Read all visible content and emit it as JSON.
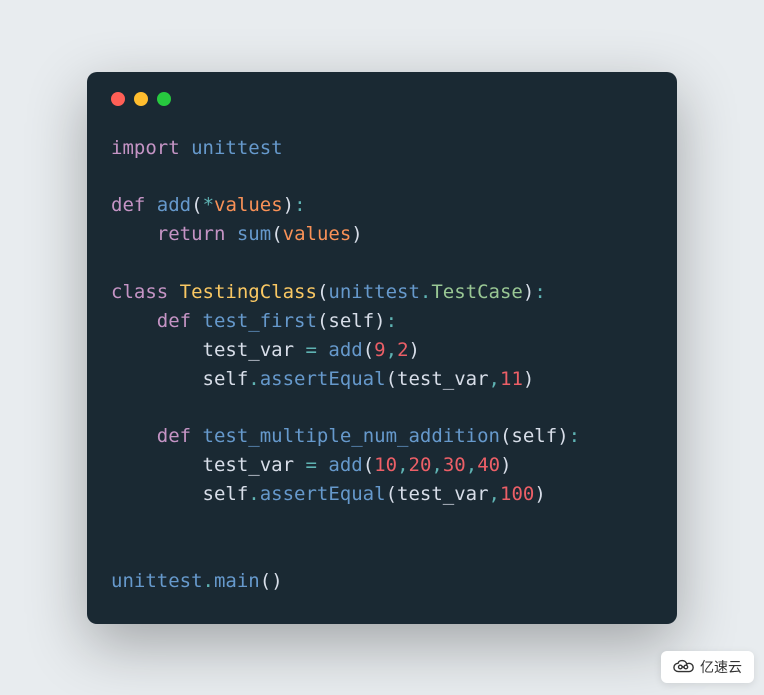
{
  "code": {
    "line1": {
      "kw": "import",
      "mod": "unittest"
    },
    "line3": {
      "kw": "def",
      "fn": "add",
      "star": "*",
      "param": "values"
    },
    "line4": {
      "kw": "return",
      "fn": "sum",
      "param": "values"
    },
    "line6": {
      "kw": "class",
      "cls": "TestingClass",
      "mod": "unittest",
      "prop": "TestCase"
    },
    "line7": {
      "kw": "def",
      "fn": "test_first",
      "self": "self"
    },
    "line8": {
      "var": "test_var",
      "op": "=",
      "fn": "add",
      "n1": "9",
      "n2": "2"
    },
    "line9": {
      "self": "self",
      "fn": "assertEqual",
      "var": "test_var",
      "n": "11"
    },
    "line11": {
      "kw": "def",
      "fn": "test_multiple_num_addition",
      "self": "self"
    },
    "line12": {
      "var": "test_var",
      "op": "=",
      "fn": "add",
      "n1": "10",
      "n2": "20",
      "n3": "30",
      "n4": "40"
    },
    "line13": {
      "self": "self",
      "fn": "assertEqual",
      "var": "test_var",
      "n": "100"
    },
    "line16": {
      "mod": "unittest",
      "fn": "main"
    }
  },
  "watermark": "亿速云",
  "colors": {
    "bg": "#1a2933",
    "keyword": "#c594c5",
    "module": "#6699cc",
    "class": "#fac863",
    "property": "#99c794",
    "param": "#f99157",
    "number": "#ec5f67",
    "operator": "#5fb3b3"
  }
}
